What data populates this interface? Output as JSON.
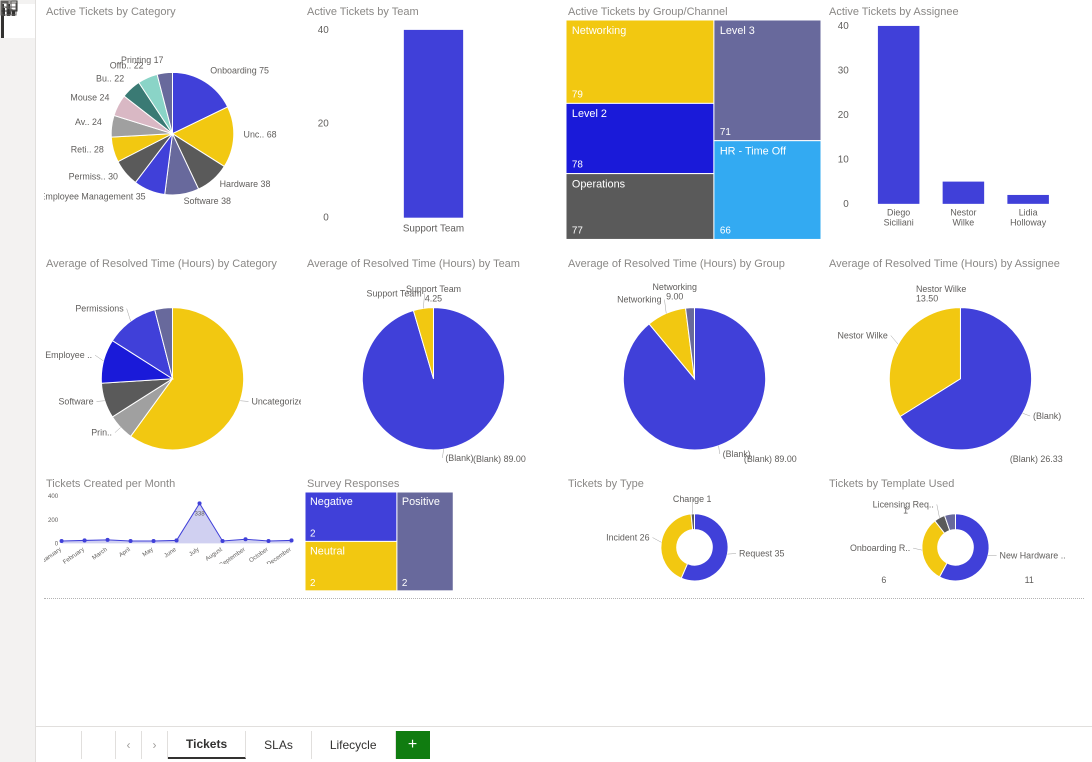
{
  "sidebar": {
    "views": [
      "report-view",
      "data-view",
      "model-view"
    ]
  },
  "titles": {
    "cat": "Active Tickets by Category",
    "team": "Active Tickets by Team",
    "group": "Active Tickets by Group/Channel",
    "assignee": "Active Tickets by Assignee",
    "rcat": "Average of Resolved Time (Hours) by Category",
    "rteam": "Average of Resolved Time (Hours) by Team",
    "rgroup": "Average of Resolved Time (Hours) by Group",
    "rassignee": "Average of Resolved Time (Hours) by Assignee",
    "month": "Tickets Created per Month",
    "survey": "Survey Responses",
    "type": "Tickets by Type",
    "template": "Tickets by Template Used"
  },
  "chart_data": [
    {
      "id": "cat",
      "type": "pie",
      "title": "Active Tickets by Category",
      "series": [
        {
          "name": "Onboarding",
          "value": 75,
          "color": "#4040d9"
        },
        {
          "name": "Unc..",
          "value": 68,
          "color": "#f2c811"
        },
        {
          "name": "Hardware",
          "value": 38,
          "color": "#5a5a5a"
        },
        {
          "name": "Software",
          "value": 38,
          "color": "#68699c"
        },
        {
          "name": "Employee Management",
          "value": 35,
          "color": "#4040d9"
        },
        {
          "name": "Permiss..",
          "value": 30,
          "color": "#5a5a5a"
        },
        {
          "name": "Reti..",
          "value": 28,
          "color": "#f2c811"
        },
        {
          "name": "Av..",
          "value": 24,
          "color": "#a0a0a0"
        },
        {
          "name": "Mouse",
          "value": 24,
          "color": "#d9b8c4"
        },
        {
          "name": "Bu..",
          "value": 22,
          "color": "#3a7a74"
        },
        {
          "name": "Offb..",
          "value": 22,
          "color": "#8ad4c7"
        },
        {
          "name": "Printing",
          "value": 17,
          "color": "#68699c"
        }
      ]
    },
    {
      "id": "team",
      "type": "bar",
      "title": "Active Tickets by Team",
      "categories": [
        "Support Team"
      ],
      "values": [
        45
      ],
      "ylim": [
        0,
        40
      ],
      "ticks": [
        0,
        20,
        40
      ]
    },
    {
      "id": "group",
      "type": "treemap",
      "title": "Active Tickets by Group/Channel",
      "items": [
        {
          "name": "Networking",
          "value": 79,
          "color": "#f2c811"
        },
        {
          "name": "Level 2",
          "value": 78,
          "color": "#1a1ad9"
        },
        {
          "name": "Operations",
          "value": 77,
          "color": "#5a5a5a"
        },
        {
          "name": "Level 3",
          "value": 71,
          "color": "#68699c"
        },
        {
          "name": "HR - Time Off",
          "value": 66,
          "color": "#33aaf2"
        }
      ]
    },
    {
      "id": "assignee",
      "type": "bar",
      "title": "Active Tickets by Assignee",
      "categories": [
        "Diego Siciliani",
        "Nestor Wilke",
        "Lidia Holloway"
      ],
      "values": [
        40,
        5,
        2
      ],
      "ylim": [
        0,
        40
      ],
      "ticks": [
        0,
        10,
        20,
        30,
        40
      ]
    },
    {
      "id": "rcat",
      "type": "pie",
      "title": "Average of Resolved Time (Hours) by Category",
      "series": [
        {
          "name": "Uncategorized",
          "value": 60,
          "color": "#f2c811"
        },
        {
          "name": "Prin..",
          "value": 6,
          "color": "#a0a0a0"
        },
        {
          "name": "Software",
          "value": 8,
          "color": "#5a5a5a"
        },
        {
          "name": "Employee ..",
          "value": 10,
          "color": "#1a1ad9"
        },
        {
          "name": "Permissions",
          "value": 12,
          "color": "#4040d9"
        },
        {
          "name": "",
          "value": 4,
          "color": "#68699c"
        }
      ]
    },
    {
      "id": "rteam",
      "type": "pie",
      "title": "Average of Resolved Time (Hours) by Team",
      "series": [
        {
          "name": "(Blank)",
          "value": 89.0,
          "color": "#4040d9"
        },
        {
          "name": "Support Team",
          "value": 4.25,
          "color": "#f2c811"
        }
      ]
    },
    {
      "id": "rgroup",
      "type": "pie",
      "title": "Average of Resolved Time (Hours) by Group",
      "series": [
        {
          "name": "(Blank)",
          "value": 89.0,
          "color": "#4040d9"
        },
        {
          "name": "Networking",
          "value": 9.0,
          "color": "#f2c811"
        },
        {
          "name": "",
          "value": 2,
          "color": "#68699c"
        }
      ]
    },
    {
      "id": "rassignee",
      "type": "pie",
      "title": "Average of Resolved Time (Hours) by Assignee",
      "series": [
        {
          "name": "(Blank)",
          "value": 26.33,
          "color": "#4040d9"
        },
        {
          "name": "Nestor Wilke",
          "value": 13.5,
          "color": "#f2c811"
        }
      ]
    },
    {
      "id": "month",
      "type": "area",
      "title": "Tickets Created per Month",
      "x": [
        "January",
        "February",
        "March",
        "April",
        "May",
        "June",
        "July",
        "August",
        "September",
        "October",
        "December"
      ],
      "y": [
        20,
        25,
        30,
        20,
        20,
        25,
        338,
        20,
        35,
        20,
        25
      ],
      "ylim": [
        0,
        400
      ],
      "ticks": [
        0,
        200,
        400
      ],
      "highlight": {
        "index": 6,
        "label": "338"
      }
    },
    {
      "id": "survey",
      "type": "treemap",
      "title": "Survey Responses",
      "items": [
        {
          "name": "Negative",
          "value": 2,
          "color": "#4040d9"
        },
        {
          "name": "Neutral",
          "value": 2,
          "color": "#f2c811"
        },
        {
          "name": "Positive",
          "value": 2,
          "color": "#68699c"
        }
      ]
    },
    {
      "id": "type",
      "type": "donut",
      "title": "Tickets by Type",
      "series": [
        {
          "name": "Request",
          "value": 35,
          "color": "#4040d9"
        },
        {
          "name": "Incident",
          "value": 26,
          "color": "#f2c811"
        },
        {
          "name": "Change",
          "value": 1,
          "color": "#5a5a5a"
        }
      ]
    },
    {
      "id": "template",
      "type": "donut",
      "title": "Tickets by Template Used",
      "series": [
        {
          "name": "New Hardware ..",
          "value": 11,
          "color": "#4040d9"
        },
        {
          "name": "Onboarding R..",
          "value": 6,
          "color": "#f2c811"
        },
        {
          "name": "Licensing Req..",
          "value": 1,
          "color": "#5a5a5a"
        },
        {
          "name": "",
          "value": 1,
          "color": "#68699c"
        }
      ]
    }
  ],
  "footer": {
    "tabs": [
      {
        "id": "tickets",
        "label": "Tickets",
        "active": true
      },
      {
        "id": "slas",
        "label": "SLAs",
        "active": false
      },
      {
        "id": "lifecycle",
        "label": "Lifecycle",
        "active": false
      }
    ],
    "add": "+"
  }
}
